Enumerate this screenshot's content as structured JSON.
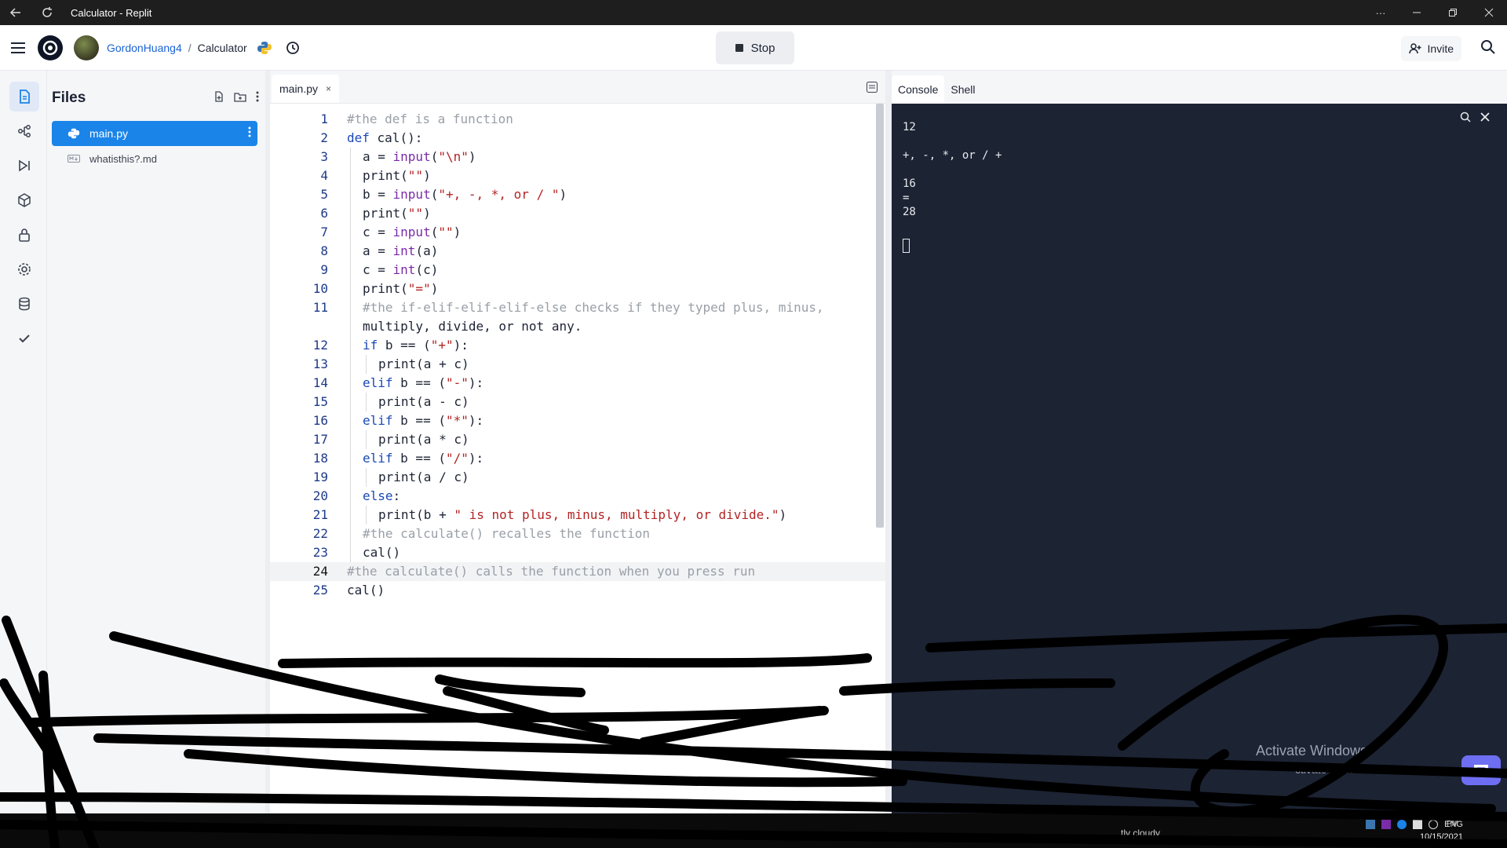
{
  "window": {
    "title": "Calculator - Replit"
  },
  "header": {
    "username": "GordonHuang4",
    "separator": "/",
    "repl_name": "Calculator",
    "stop_label": "Stop",
    "invite_label": "Invite"
  },
  "files": {
    "title": "Files",
    "items": [
      {
        "name": "main.py",
        "selected": true
      },
      {
        "name": "whatisthis?.md",
        "selected": false
      }
    ]
  },
  "editor": {
    "tab_label": "main.py",
    "tab_close": "×",
    "current_line": 24,
    "lines": [
      {
        "n": "1",
        "indent": 0,
        "text": "#the def is a function"
      },
      {
        "n": "2",
        "indent": 0,
        "text": "def cal():"
      },
      {
        "n": "3",
        "indent": 1,
        "text": "a = input(\"\\n\")"
      },
      {
        "n": "4",
        "indent": 1,
        "text": "print(\"\")"
      },
      {
        "n": "5",
        "indent": 1,
        "text": "b = input(\"+, -, *, or / \")"
      },
      {
        "n": "6",
        "indent": 1,
        "text": "print(\"\")"
      },
      {
        "n": "7",
        "indent": 1,
        "text": "c = input(\"\")"
      },
      {
        "n": "8",
        "indent": 1,
        "text": "a = int(a)"
      },
      {
        "n": "9",
        "indent": 1,
        "text": "c = int(c)"
      },
      {
        "n": "10",
        "indent": 1,
        "text": "print(\"=\")"
      },
      {
        "n": "11",
        "indent": 1,
        "text": "#the if-elif-elif-elif-else checks if they typed plus, minus,"
      },
      {
        "n": "",
        "indent": 1,
        "text": "multiply, divide, or not any."
      },
      {
        "n": "12",
        "indent": 1,
        "text": "if b == (\"+\"):"
      },
      {
        "n": "13",
        "indent": 2,
        "text": "print(a + c)"
      },
      {
        "n": "14",
        "indent": 1,
        "text": "elif b == (\"-\"):"
      },
      {
        "n": "15",
        "indent": 2,
        "text": "print(a - c)"
      },
      {
        "n": "16",
        "indent": 1,
        "text": "elif b == (\"*\"):"
      },
      {
        "n": "17",
        "indent": 2,
        "text": "print(a * c)"
      },
      {
        "n": "18",
        "indent": 1,
        "text": "elif b == (\"/\"):"
      },
      {
        "n": "19",
        "indent": 2,
        "text": "print(a / c)"
      },
      {
        "n": "20",
        "indent": 1,
        "text": "else:"
      },
      {
        "n": "21",
        "indent": 2,
        "text": "print(b + \" is not plus, minus, multiply, or divide.\")"
      },
      {
        "n": "22",
        "indent": 1,
        "text": "#the calculate() recalles the function"
      },
      {
        "n": "23",
        "indent": 1,
        "text": "cal()"
      },
      {
        "n": "24",
        "indent": 0,
        "text": "#the calculate() calls the function when you press run"
      },
      {
        "n": "25",
        "indent": 0,
        "text": "cal()"
      }
    ]
  },
  "console": {
    "tabs": [
      "Console",
      "Shell"
    ],
    "active_tab": "Console",
    "output": [
      "12",
      "",
      "+, -, *, or / +",
      "",
      "16",
      "=",
      "28"
    ]
  },
  "os": {
    "watermark_title": "Activate Windows",
    "watermark_sub": "ctivate Windows.",
    "weather": "tly cloudy",
    "lang": "ENG",
    "time": "PM",
    "date": "10/15/2021"
  },
  "colors": {
    "accent": "#1a84e8",
    "console_bg": "#1c2333",
    "chat_button": "#6e6ef2"
  },
  "icons": [
    "back-arrow-icon",
    "reload-icon",
    "more-icon",
    "minimize-icon",
    "restore-icon",
    "close-icon",
    "hamburger-icon",
    "replit-logo-icon",
    "python-icon",
    "history-icon",
    "stop-icon",
    "invite-icon",
    "search-icon",
    "files-icon",
    "version-control-icon",
    "debugger-icon",
    "packages-icon",
    "secrets-icon",
    "settings-icon",
    "database-icon",
    "unit-tests-icon",
    "new-file-icon",
    "new-folder-icon",
    "layout-icon",
    "chat-icon"
  ]
}
